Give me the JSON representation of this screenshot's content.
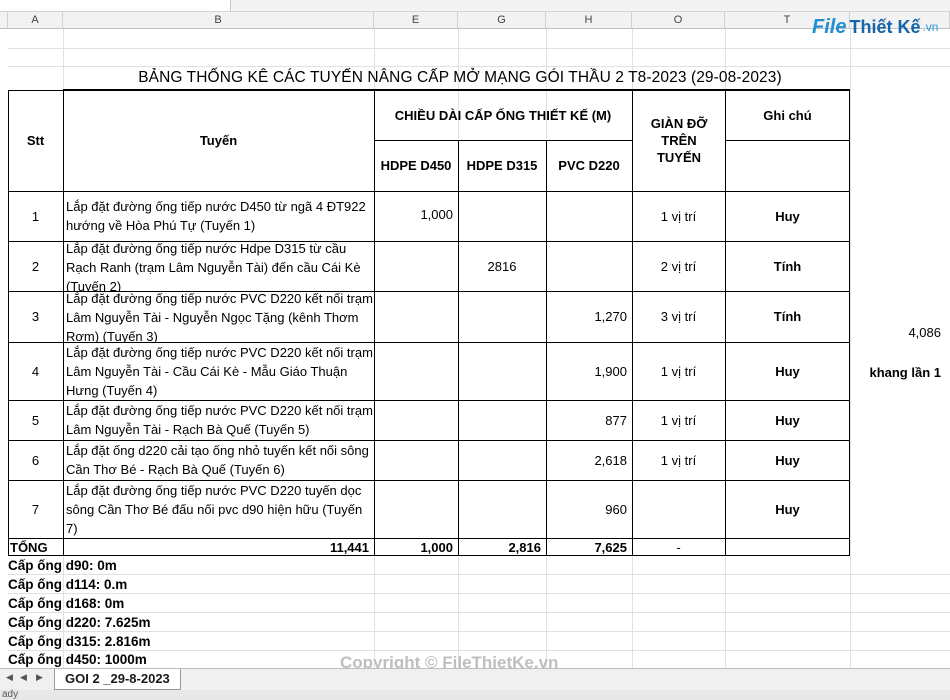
{
  "columns": [
    "A",
    "B",
    "E",
    "G",
    "H",
    "O",
    "T"
  ],
  "title": "BẢNG THỐNG KÊ CÁC TUYẾN NÂNG CẤP MỞ MẠNG  GÓI THẦU 2 T8-2023 (29-08-2023)",
  "headers": {
    "stt": "Stt",
    "tuyen": "Tuyến",
    "chieu_dai": "CHIỀU DÀI CẤP ỐNG THIẾT KẾ (M)",
    "hdpe450": "HDPE D450",
    "hdpe315": "HDPE D315",
    "pvc220": "PVC D220",
    "gian_do": "GIÀN ĐỠ TRÊN TUYẾN",
    "ghi_chu": "Ghi chú"
  },
  "rows": [
    {
      "stt": "1",
      "desc": "Lắp đặt đường ống tiếp nước D450 từ  ngã 4 ĐT922 hướng về Hòa Phú Tự (Tuyến 1)",
      "d450": "1,000",
      "d315": "",
      "d220": "",
      "gian": "1 vị trí",
      "note": "Huy"
    },
    {
      "stt": "2",
      "desc": "Lắp đặt đường ống tiếp nước Hdpe D315 từ cầu Rạch Ranh (trạm Lâm Nguyễn Tài) đến cầu Cái Kè (Tuyến 2)",
      "d450": "",
      "d315": "2816",
      "d220": "",
      "gian": "2 vị trí",
      "note": "Tính"
    },
    {
      "stt": "3",
      "desc": "Lắp đặt đường ống tiếp nước PVC D220 kết nối trạm Lâm Nguyễn Tài - Nguyễn Ngọc Tặng (kênh Thơm Rơm) (Tuyến 3)",
      "d450": "",
      "d315": "",
      "d220": "1,270",
      "gian": "3 vị trí",
      "note": "Tính"
    },
    {
      "stt": "4",
      "desc": "Lắp đặt đường ống tiếp nước PVC D220 kết nối trạm Lâm Nguyễn Tài - Cầu Cái Kè - Mẫu Giáo Thuận Hưng (Tuyến 4)",
      "d450": "",
      "d315": "",
      "d220": "1,900",
      "gian": "1 vị trí",
      "note": "Huy"
    },
    {
      "stt": "5",
      "desc": "Lắp đặt đường ống tiếp nước PVC D220 kết nối trạm Lâm Nguyễn Tài - Rạch Bà Quế (Tuyến 5)",
      "d450": "",
      "d315": "",
      "d220": "877",
      "gian": "1 vị trí",
      "note": "Huy"
    },
    {
      "stt": "6",
      "desc": "Lắp đặt ống d220 cải tạo ống nhỏ tuyến kết nối sông Cần Thơ Bé - Rạch Bà Quế (Tuyến 6)",
      "d450": "",
      "d315": "",
      "d220": "2,618",
      "gian": "1 vị trí",
      "note": "Huy"
    },
    {
      "stt": "7",
      "desc": "Lắp đặt đường ống tiếp nước PVC D220 tuyến dọc sông Cần Thơ Bé đấu nối pvc d90 hiện hữu (Tuyến 7)",
      "d450": "",
      "d315": "",
      "d220": "960",
      "gian": "",
      "note": "Huy"
    }
  ],
  "total": {
    "label": "TỔNG",
    "sum": "11,441",
    "d450": "1,000",
    "d315": "2,816",
    "d220": "7,625",
    "gian": "-"
  },
  "extra": {
    "value": "4,086",
    "text": "khang lần 1"
  },
  "notes": [
    "Cấp ống d90: 0m",
    "Cấp ống d114: 0.m",
    "Cấp ống d168: 0m",
    "Cấp ống d220: 7.625m",
    "Cấp ống d315: 2.816m",
    "Cấp ống d450: 1000m"
  ],
  "sheet_tab": "GOI 2 _29-8-2023",
  "status": "ady",
  "logo": {
    "f": "File",
    "t": "Thiết Kế",
    "v": ".vn"
  },
  "watermark": "Copyright © FileThietKe.vn"
}
